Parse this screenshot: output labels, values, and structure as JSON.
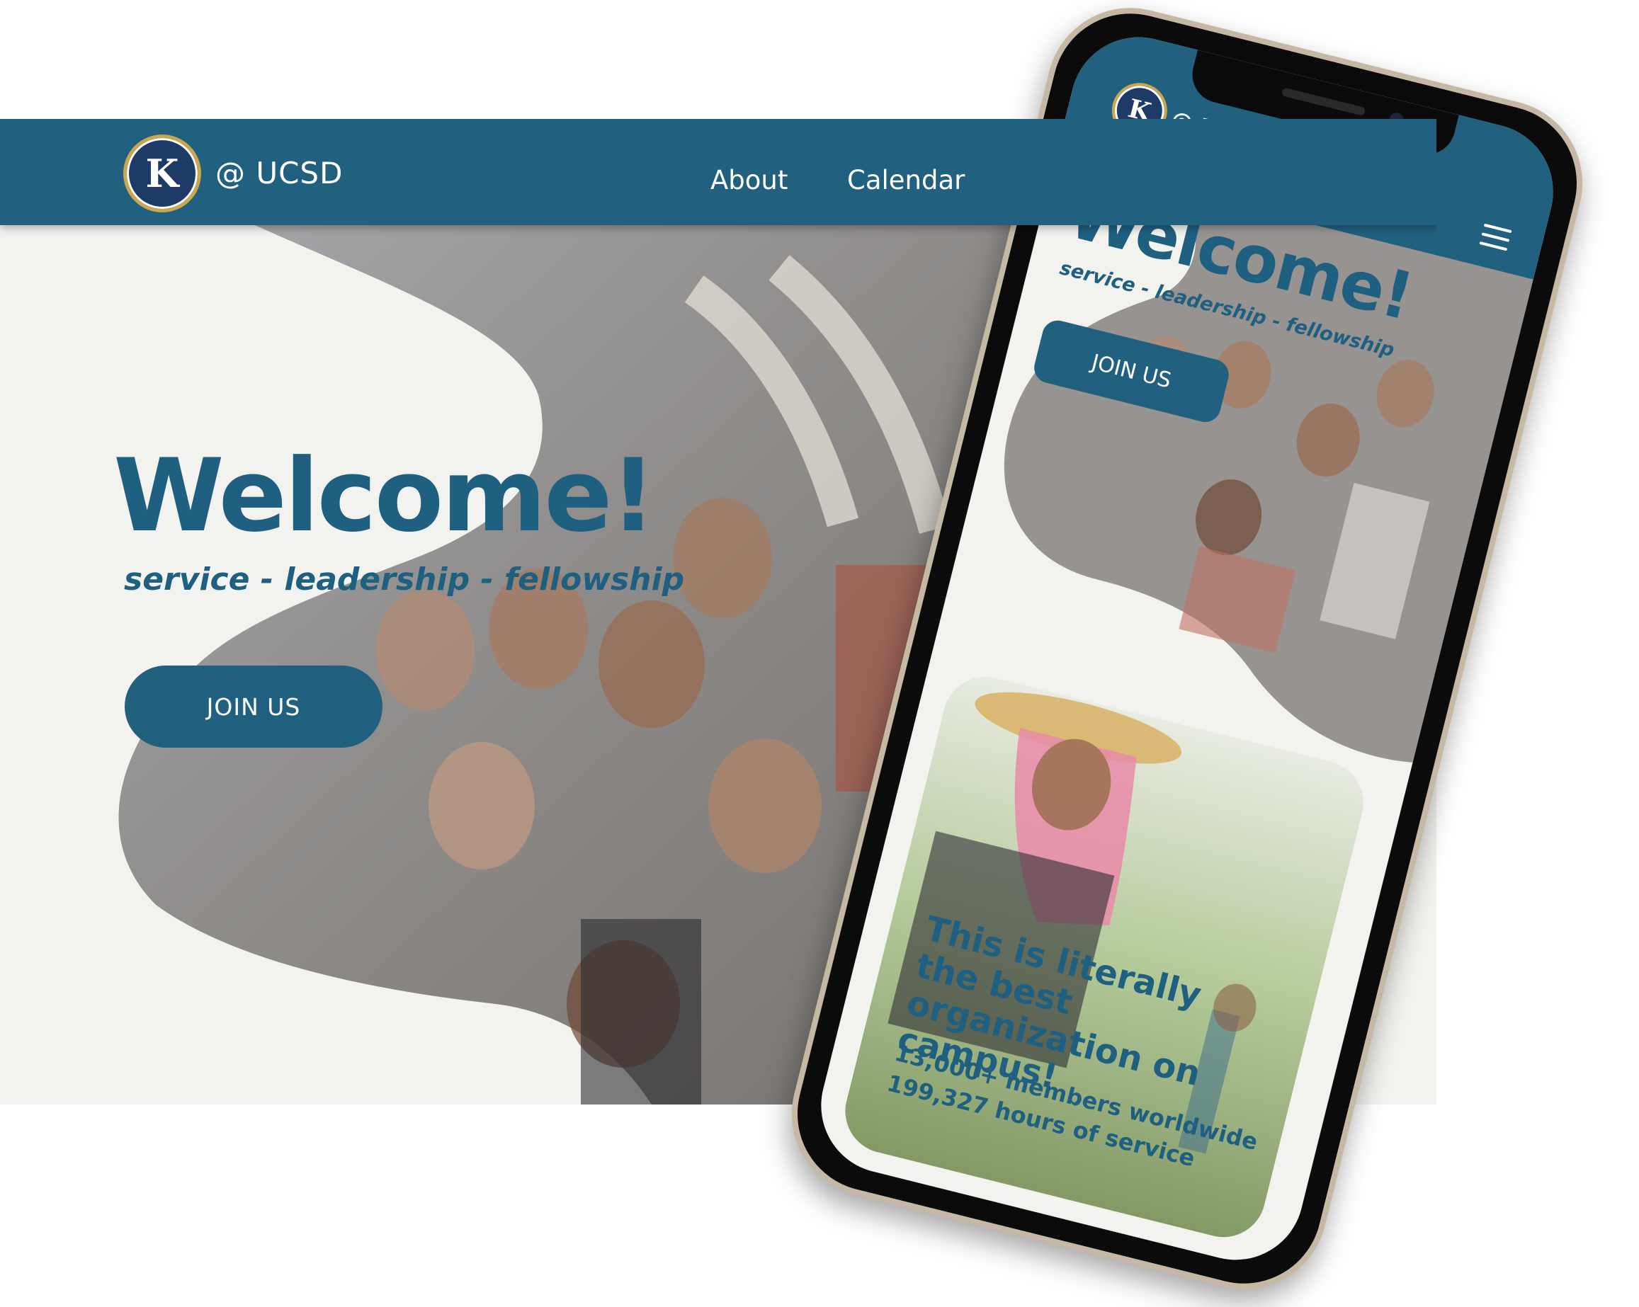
{
  "desktop": {
    "nav": {
      "logo_text": "CIRCLE K INTERNATIONAL",
      "brand": "@ UCSD",
      "links": [
        {
          "label": "About"
        },
        {
          "label": "Calendar"
        }
      ]
    },
    "hero": {
      "title": "Welcome!",
      "tagline": "service - leadership - fellowship",
      "cta": "JOIN US"
    }
  },
  "phone": {
    "nav": {
      "logo_text": "CIRCLE K INTERNATIONAL",
      "brand": "@ UCSD",
      "menu_icon": "hamburger-menu-icon"
    },
    "hero": {
      "title": "Welcome!",
      "tagline": "service  - leadership - fellowship",
      "cta": "JOIN US"
    },
    "card": {
      "title": "This is literally the best organization on campus!",
      "stats": [
        "13,000+ members worldwide",
        "199,327 hours of service"
      ]
    }
  },
  "colors": {
    "primary": "#22607f",
    "heading": "#1f5f80",
    "background": "#f2f2ef",
    "logo_navy": "#1e3a66",
    "logo_gold": "#c8a74e"
  }
}
